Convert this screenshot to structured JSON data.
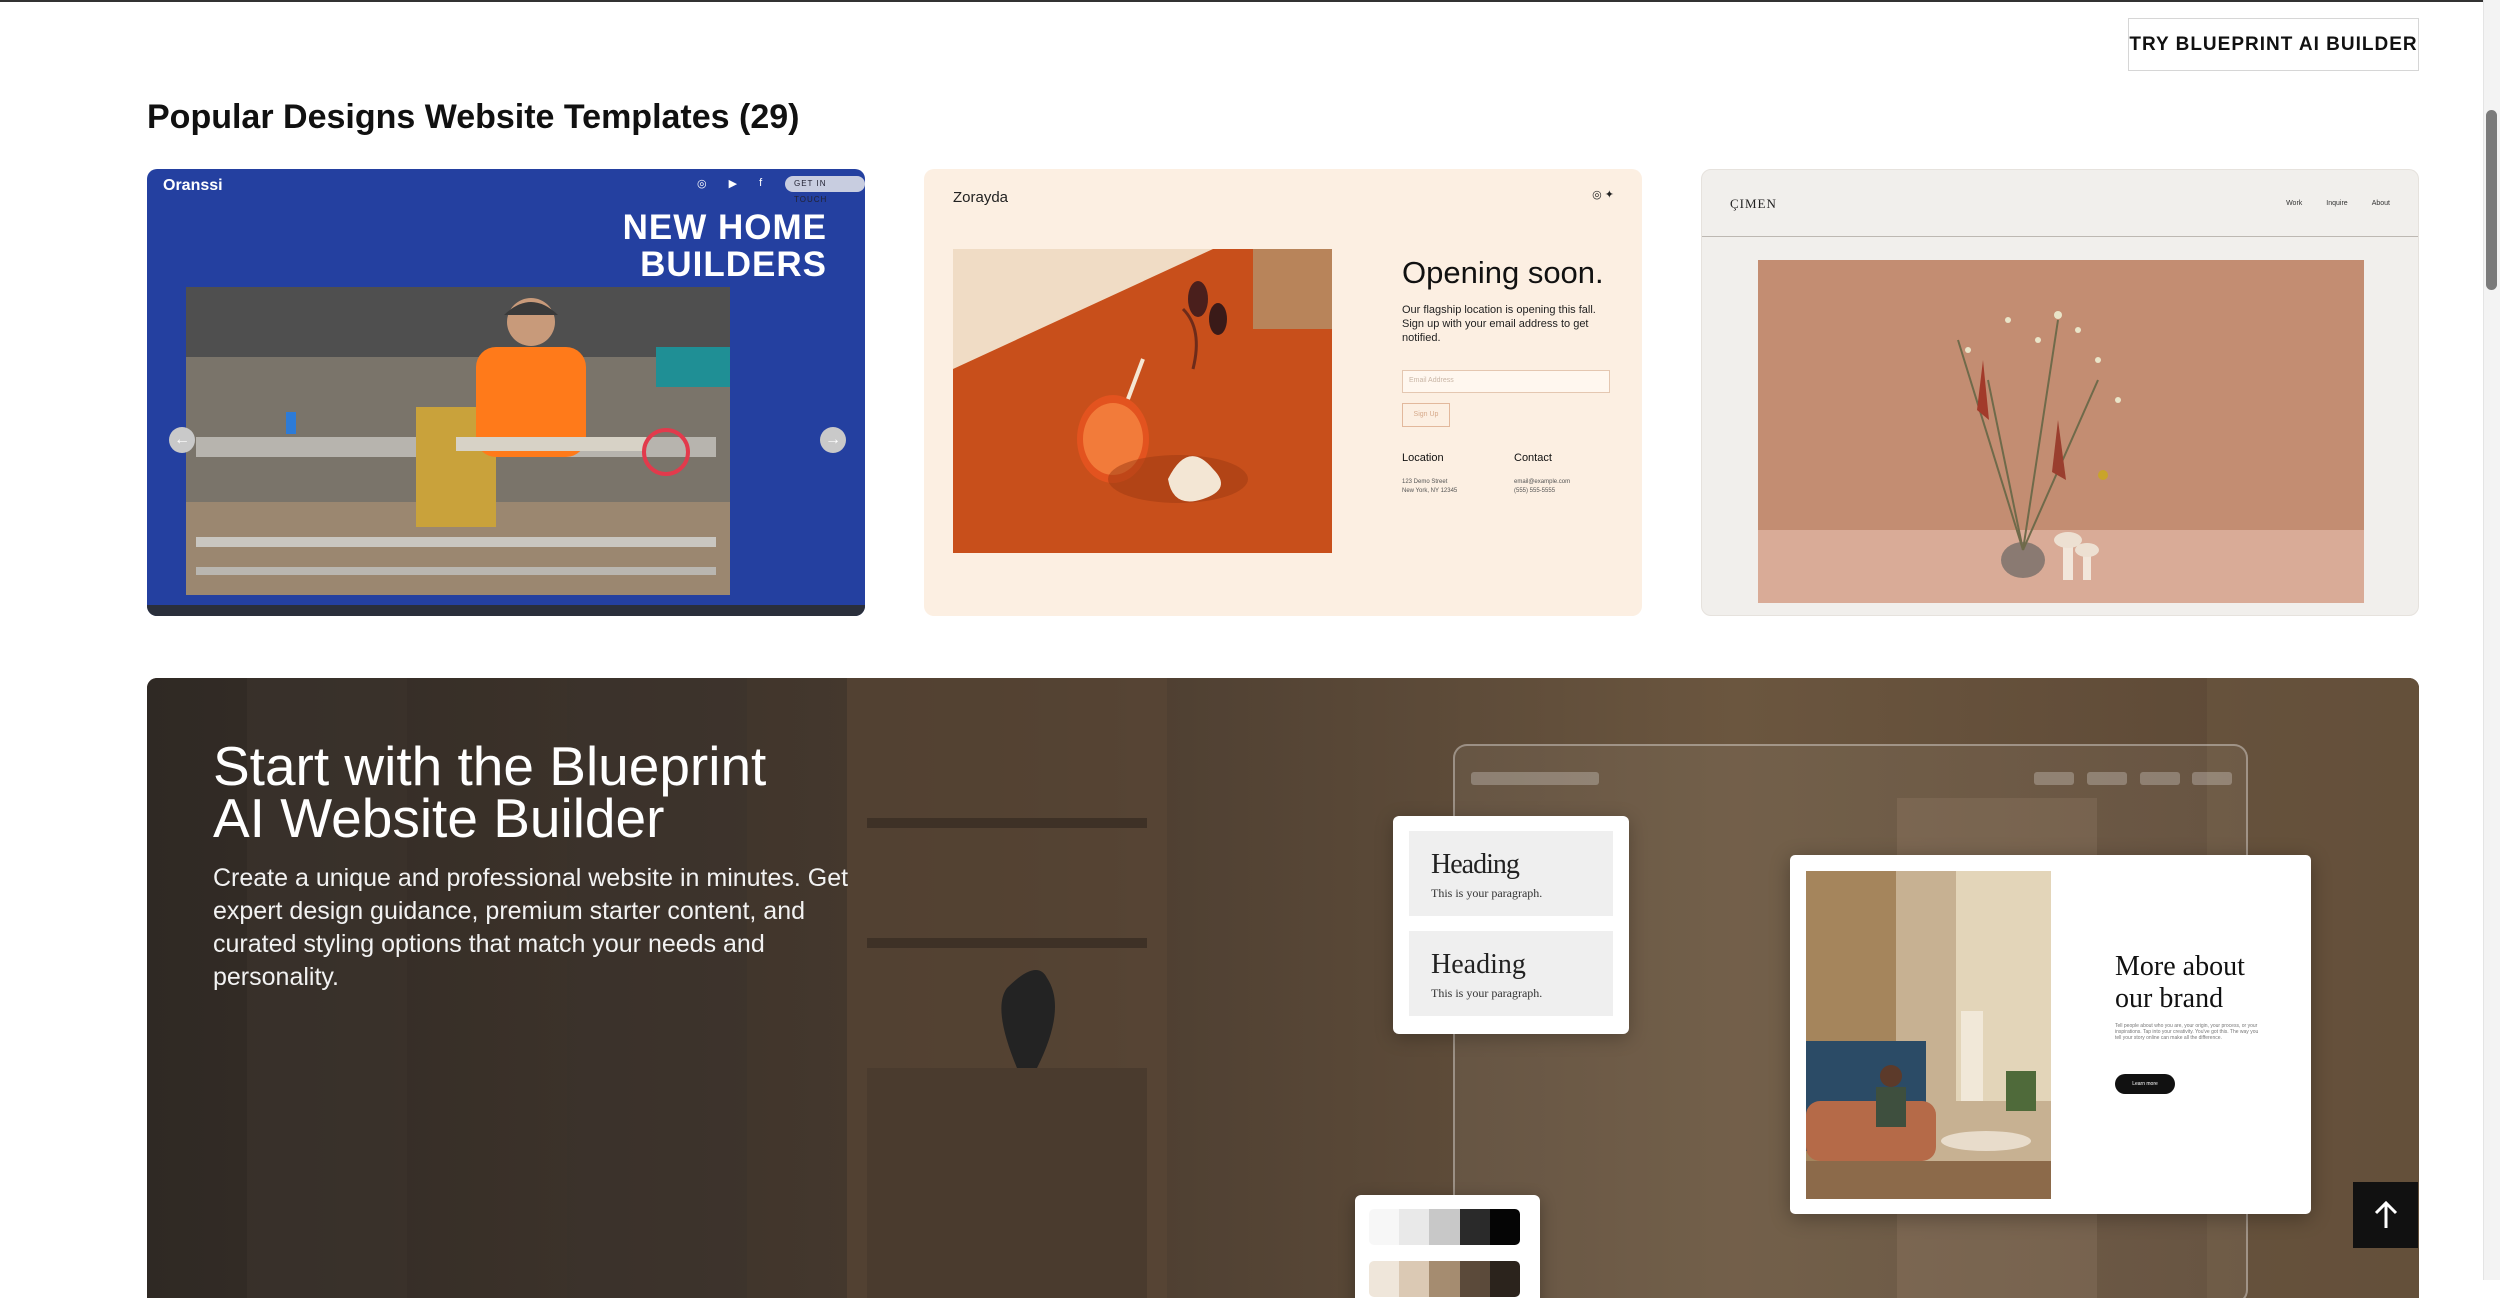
{
  "header": {
    "try_button": "TRY BLUEPRINT AI BUILDER"
  },
  "section": {
    "title": "Popular Designs Website Templates (29)"
  },
  "templates": [
    {
      "brand": "Oranssi",
      "icons": [
        "instagram-icon",
        "youtube-icon",
        "facebook-icon"
      ],
      "pill": "GET IN TOUCH",
      "headline_1": "NEW HOME",
      "headline_2": "BUILDERS",
      "arrows": [
        "←",
        "→"
      ]
    },
    {
      "brand": "Zorayda",
      "title": "Opening soon.",
      "text": "Our flagship location is opening this fall. Sign up with your email address to get notified.",
      "email_placeholder": "Email Address",
      "signup": "Sign Up",
      "location_label": "Location",
      "location_line1": "123 Demo Street",
      "location_line2": "New York, NY 12345",
      "contact_label": "Contact",
      "contact_line1": "email@example.com",
      "contact_line2": "(555) 555-5555"
    },
    {
      "brand": "ÇIMEN",
      "nav": [
        "Work",
        "Inquire",
        "About"
      ]
    }
  ],
  "banner": {
    "title_line1": "Start with the Blueprint",
    "title_line2": "AI Website Builder",
    "description": "Create a unique and professional website in minutes. Get expert design guidance, premium starter content, and curated styling options that match your needs and personality.",
    "heading_1": "Heading",
    "paragraph_1": "This is your paragraph.",
    "heading_2": "Heading",
    "paragraph_2": "This is your paragraph.",
    "brand_title_1": "More about",
    "brand_title_2": "our brand",
    "brand_text": "Tell people about who you are, your origin, your process, or your inspirations. Tap into your creativity. You've got this. The way you tell your story online can make all the difference.",
    "brand_button": "Learn more",
    "palettes": [
      [
        "#f7f7f7",
        "#e9e9e9",
        "#c8c8c8",
        "#2a2a2a",
        "#050505"
      ],
      [
        "#efe6da",
        "#dbc9b4",
        "#a58c70",
        "#5b4a3a",
        "#2b231c"
      ]
    ]
  },
  "scroll_top_icon": "arrow-up-icon"
}
